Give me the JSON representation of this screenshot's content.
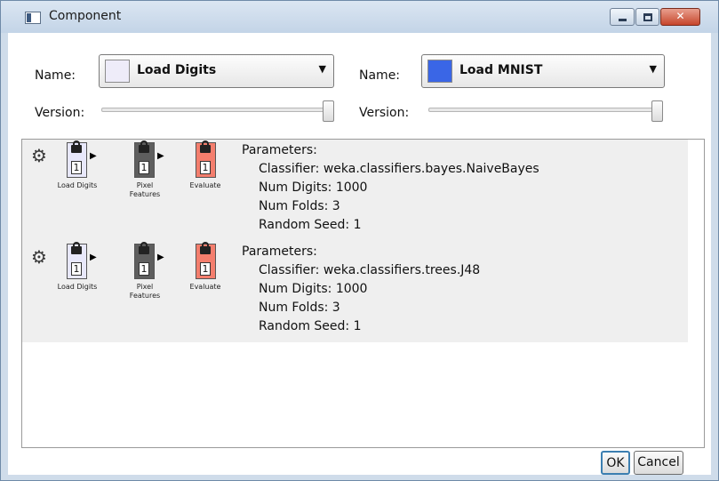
{
  "window": {
    "title": "Component"
  },
  "left_component": {
    "name_label": "Name:",
    "selected": "Load Digits",
    "swatch_color": "#eeecf9",
    "version_label": "Version:",
    "version_level": 1.0
  },
  "right_component": {
    "name_label": "Name:",
    "selected": "Load MNIST",
    "swatch_color": "#3a66e6",
    "version_label": "Version:",
    "version_level": 1.0
  },
  "runs": [
    {
      "pipeline": [
        {
          "label": "Load Digits",
          "version": "1",
          "color": "#e8e8fb"
        },
        {
          "label": "Pixel Features",
          "version": "1",
          "color": "#5e5e5e"
        },
        {
          "label": "Evaluate",
          "version": "1",
          "color": "#f47e6d"
        }
      ],
      "params_heading": "Parameters:",
      "params": [
        "Classifier: weka.classifiers.bayes.NaiveBayes",
        "Num Digits: 1000",
        "Num Folds: 3",
        "Random Seed: 1"
      ]
    },
    {
      "pipeline": [
        {
          "label": "Load Digits",
          "version": "1",
          "color": "#e8e8fb"
        },
        {
          "label": "Pixel Features",
          "version": "1",
          "color": "#5e5e5e"
        },
        {
          "label": "Evaluate",
          "version": "1",
          "color": "#f47e6d"
        }
      ],
      "params_heading": "Parameters:",
      "params": [
        "Classifier: weka.classifiers.trees.J48",
        "Num Digits: 1000",
        "Num Folds: 3",
        "Random Seed: 1"
      ]
    }
  ],
  "buttons": {
    "ok": "OK",
    "cancel": "Cancel"
  }
}
